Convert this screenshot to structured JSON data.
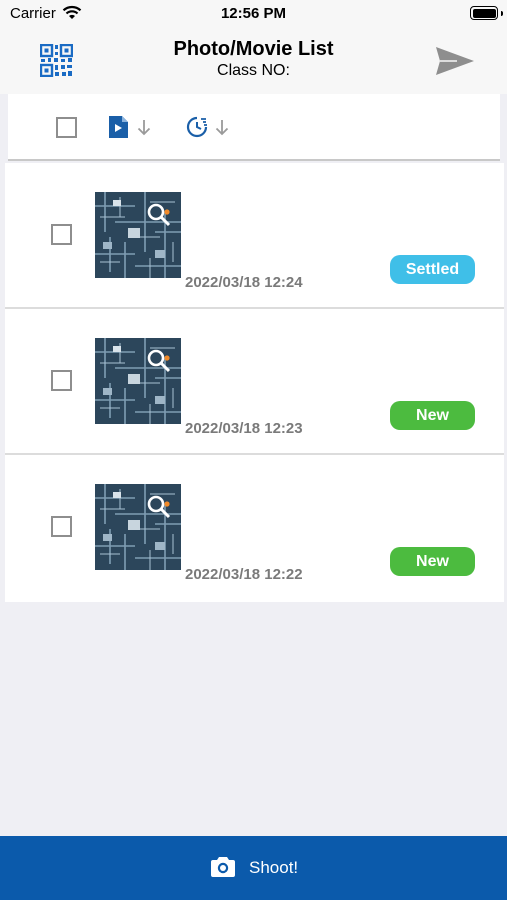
{
  "status_bar": {
    "carrier": "Carrier",
    "time": "12:56 PM"
  },
  "nav": {
    "title": "Photo/Movie List",
    "subtitle": "Class NO:",
    "left_icon": "qr-code-icon",
    "right_icon": "send-icon"
  },
  "toolbar": {
    "select_all_checked": false,
    "sort_file_icon": "file-video-icon",
    "sort_time_icon": "clock-icon"
  },
  "items": [
    {
      "timestamp": "2022/03/18 12:24",
      "status": "Settled",
      "status_color": "#3fbfe8",
      "checked": false
    },
    {
      "timestamp": "2022/03/18 12:23",
      "status": "New",
      "status_color": "#4cbb3f",
      "checked": false
    },
    {
      "timestamp": "2022/03/18 12:22",
      "status": "New",
      "status_color": "#4cbb3f",
      "checked": false
    }
  ],
  "bottom": {
    "shoot_label": "Shoot!",
    "icon": "camera-icon"
  },
  "colors": {
    "accent": "#0b5aab",
    "settled": "#3fbfe8",
    "new": "#4cbb3f"
  }
}
